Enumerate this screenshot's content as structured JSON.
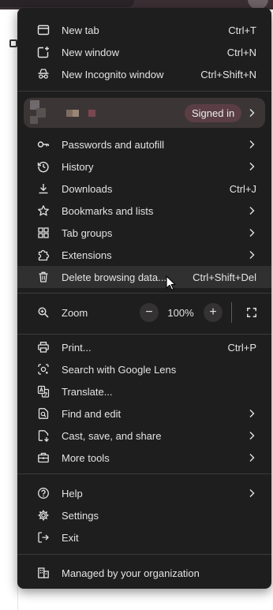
{
  "menu": {
    "new_tab": {
      "label": "New tab",
      "shortcut": "Ctrl+T",
      "icon": "new-tab-icon"
    },
    "new_window": {
      "label": "New window",
      "shortcut": "Ctrl+N",
      "icon": "new-window-icon"
    },
    "new_incognito": {
      "label": "New Incognito window",
      "shortcut": "Ctrl+Shift+N",
      "icon": "incognito-icon"
    },
    "profile": {
      "badge": "Signed in"
    },
    "passwords": {
      "label": "Passwords and autofill",
      "icon": "key-icon"
    },
    "history": {
      "label": "History",
      "icon": "history-icon"
    },
    "downloads": {
      "label": "Downloads",
      "shortcut": "Ctrl+J",
      "icon": "download-icon"
    },
    "bookmarks": {
      "label": "Bookmarks and lists",
      "icon": "star-icon"
    },
    "tab_groups": {
      "label": "Tab groups",
      "icon": "grid-icon"
    },
    "extensions": {
      "label": "Extensions",
      "icon": "puzzle-icon"
    },
    "delete_data": {
      "label": "Delete browsing data...",
      "shortcut": "Ctrl+Shift+Del",
      "icon": "trash-icon"
    },
    "zoom": {
      "label": "Zoom",
      "level": "100%",
      "minus": "−",
      "plus": "+"
    },
    "print": {
      "label": "Print...",
      "shortcut": "Ctrl+P",
      "icon": "printer-icon"
    },
    "lens": {
      "label": "Search with Google Lens",
      "icon": "lens-icon"
    },
    "translate": {
      "label": "Translate...",
      "icon": "translate-icon"
    },
    "find_edit": {
      "label": "Find and edit",
      "icon": "find-icon"
    },
    "cast_save": {
      "label": "Cast, save, and share",
      "icon": "cast-icon"
    },
    "more_tools": {
      "label": "More tools",
      "icon": "toolbox-icon"
    },
    "help": {
      "label": "Help",
      "icon": "help-icon"
    },
    "settings": {
      "label": "Settings",
      "icon": "gear-icon"
    },
    "exit": {
      "label": "Exit",
      "icon": "exit-icon"
    },
    "managed": {
      "label": "Managed by your organization",
      "icon": "building-icon"
    }
  },
  "colors": {
    "menu_bg": "#1f1e1e",
    "hover_bg": "#313030",
    "profile_bg": "#3b3536",
    "signed_in_bg": "#5a3e44",
    "text": "#e3e3e3"
  }
}
